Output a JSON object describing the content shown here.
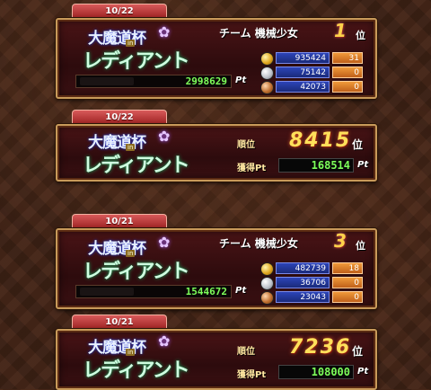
{
  "logo": {
    "line1": "大魔道杯",
    "line2": "レディアント",
    "badge": "in"
  },
  "cards": [
    {
      "type": "team",
      "date": "10/22",
      "team_label": "チーム",
      "team_name": "機械少女",
      "rank": "1",
      "rank_suffix": "位",
      "medals": [
        {
          "kind": "gold",
          "value": "935424",
          "count": "31"
        },
        {
          "kind": "silver",
          "value": "75142",
          "count": "0"
        },
        {
          "kind": "bronze",
          "value": "42073",
          "count": "0"
        }
      ],
      "points": "2998629",
      "points_unit": "Pt"
    },
    {
      "type": "individual",
      "date": "10/22",
      "rank_label": "順位",
      "rank": "8415",
      "rank_suffix": "位",
      "acquired_label": "獲得Pt",
      "acquired": "168514",
      "acquired_unit": "Pt"
    },
    {
      "type": "team",
      "date": "10/21",
      "team_label": "チーム",
      "team_name": "機械少女",
      "rank": "3",
      "rank_suffix": "位",
      "medals": [
        {
          "kind": "gold",
          "value": "482739",
          "count": "18"
        },
        {
          "kind": "silver",
          "value": "36706",
          "count": "0"
        },
        {
          "kind": "bronze",
          "value": "23043",
          "count": "0"
        }
      ],
      "points": "1544672",
      "points_unit": "Pt"
    },
    {
      "type": "individual",
      "date": "10/21",
      "rank_label": "順位",
      "rank": "7236",
      "rank_suffix": "位",
      "acquired_label": "獲得Pt",
      "acquired": "108000",
      "acquired_unit": "Pt"
    }
  ]
}
